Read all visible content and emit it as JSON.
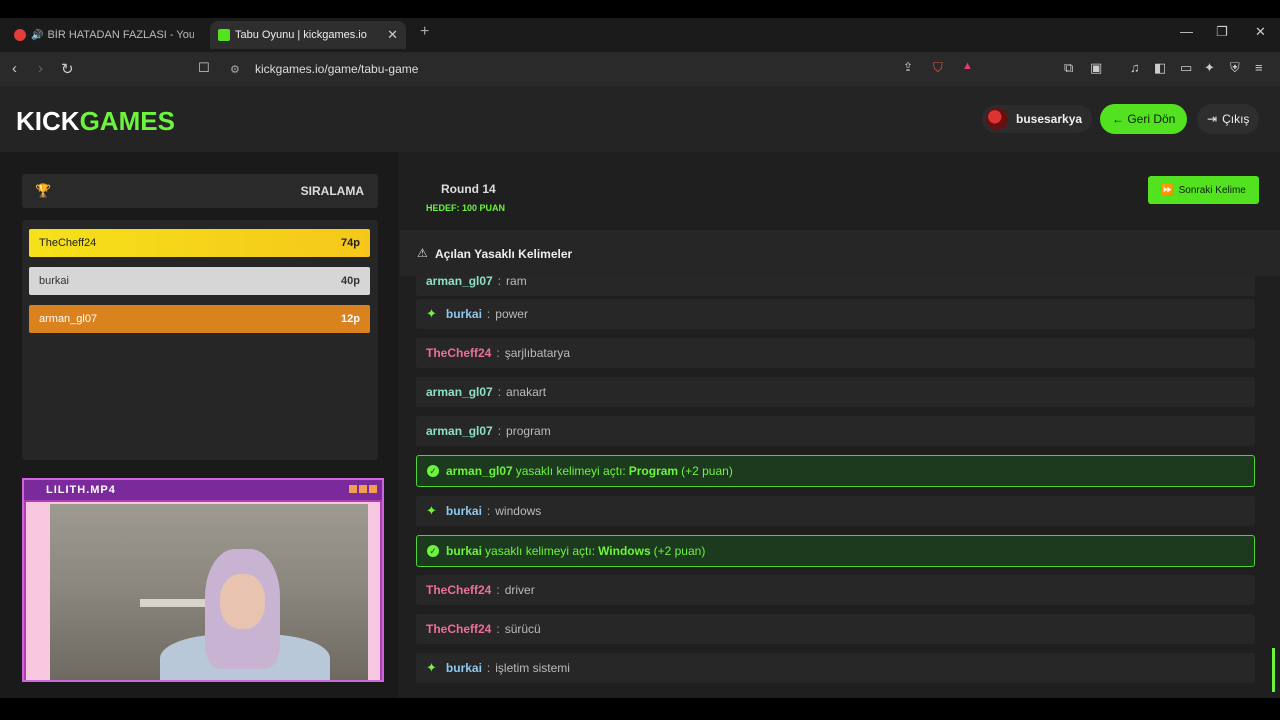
{
  "browser": {
    "tabs": [
      {
        "label": "BİR HATADAN FAZLASI - YouTube",
        "favicon_color": "#e43b3b",
        "audio": "🔊"
      },
      {
        "label": "Tabu Oyunu | kickgames.io",
        "favicon_color": "#52e21f",
        "close": "✕"
      }
    ],
    "new_tab": "+",
    "url": "kickgames.io/game/tabu-game"
  },
  "header": {
    "logo_white": "KICK",
    "logo_green": "GAMES",
    "username": "busesarkya",
    "back_label": "← Geri Dön",
    "exit_label": "Çıkış"
  },
  "ranking": {
    "title": "SIRALAMA",
    "rows": [
      {
        "name": "TheCheff24",
        "points": "74p",
        "color": "#f5d21a"
      },
      {
        "name": "burkai",
        "points": "40p",
        "color": "#d8d8d8"
      },
      {
        "name": "arman_gl07",
        "points": "12p",
        "color": "#d9821e"
      }
    ]
  },
  "stream": {
    "title": "LILITH.MP4"
  },
  "game": {
    "round": "Round 14",
    "target": "HEDEF: 100 PUAN",
    "next_label": "Sonraki Kelime",
    "forbidden_title": "Açılan Yasaklı Kelimeler"
  },
  "messages": [
    {
      "type": "msg",
      "user": "arman_gl07",
      "text": "ram",
      "cls": "user-arman",
      "star": false
    },
    {
      "type": "msg",
      "user": "burkai",
      "text": "power",
      "cls": "user-burkai",
      "star": true
    },
    {
      "type": "msg",
      "user": "TheCheff24",
      "text": "şarjlıbatarya",
      "cls": "user-chef",
      "star": false
    },
    {
      "type": "msg",
      "user": "arman_gl07",
      "text": "anakart",
      "cls": "user-arman",
      "star": false
    },
    {
      "type": "msg",
      "user": "arman_gl07",
      "text": "program",
      "cls": "user-arman",
      "star": false
    },
    {
      "type": "sys",
      "user": "arman_gl07",
      "middle": "yasaklı kelimeyi açtı:",
      "word": "Program",
      "bonus": "(+2 puan)"
    },
    {
      "type": "msg",
      "user": "burkai",
      "text": "windows",
      "cls": "user-burkai",
      "star": true
    },
    {
      "type": "sys",
      "user": "burkai",
      "middle": "yasaklı kelimeyi açtı:",
      "word": "Windows",
      "bonus": "(+2 puan)"
    },
    {
      "type": "msg",
      "user": "TheCheff24",
      "text": "driver",
      "cls": "user-chef",
      "star": false
    },
    {
      "type": "msg",
      "user": "TheCheff24",
      "text": "sürücü",
      "cls": "user-chef",
      "star": false
    },
    {
      "type": "msg",
      "user": "burkai",
      "text": "işletim sistemi",
      "cls": "user-burkai",
      "star": true
    }
  ]
}
